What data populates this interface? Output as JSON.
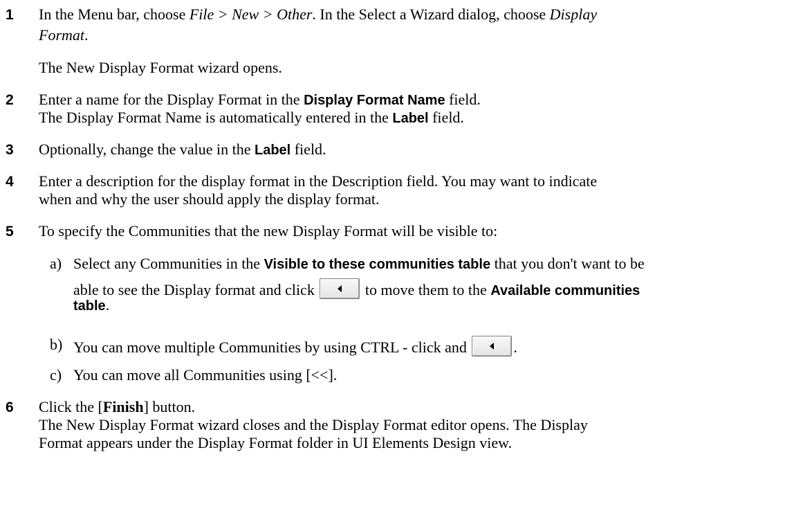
{
  "steps": [
    {
      "num": "1",
      "t1": "In the Menu bar, choose ",
      "t2": "File > New > Other",
      "t3": ". In the Select a Wizard dialog, choose ",
      "t4": "Display",
      "t5": "Format",
      "t6": ".",
      "result": "The New Display Format wizard opens."
    },
    {
      "num": "2",
      "t1": "Enter a name for the Display Format in the ",
      "t2": "Display Format Name",
      "t3": " field.",
      "t4": "The Display Format Name is automatically entered in the ",
      "t5": "Label",
      "t6": " field."
    },
    {
      "num": "3",
      "t1": "Optionally, change the value in the ",
      "t2": "Label",
      "t3": " field."
    },
    {
      "num": "4",
      "t1": " Enter a description for the display format in the Description field.  You may want to indicate",
      "t2": "when and why the user should apply the display format."
    },
    {
      "num": "5",
      "t1": "To specify the Communities that the new Display Format will be visible to:",
      "a": {
        "letter": "a)",
        "t1": "Select any Communities in the ",
        "t2": "Visible to these communities table",
        "t3": " that you don't want to be",
        "t4": "able to see the Display format and click ",
        "t5": " to move them to the ",
        "t6": "Available communities",
        "t7": "table",
        "t8": "."
      },
      "b": {
        "letter": "b)",
        "t1": "You can move multiple Communities by using CTRL - click and ",
        "t2": "."
      },
      "c": {
        "letter": "c)",
        "t1": "You can move all Communities using [<<]."
      }
    },
    {
      "num": "6",
      "t1": "Click the [",
      "t2": "Finish",
      "t3": "] button.",
      "t4": "The New Display Format wizard closes and the Display Format editor opens. The Display",
      "t5": "Format appears under the Display Format folder in UI Elements Design view."
    }
  ],
  "icons": {
    "move_left_button": "left-arrow-button-icon"
  }
}
